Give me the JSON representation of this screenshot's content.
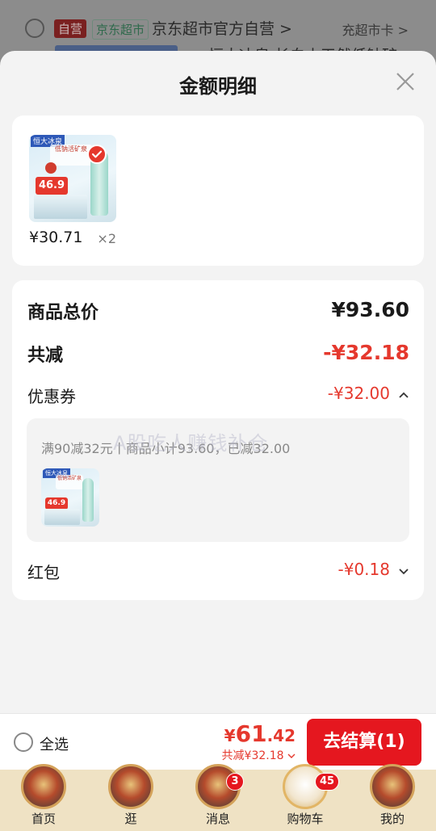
{
  "background": {
    "store_tag_self": "自营",
    "store_tag_jd": "京东超市",
    "store_name": "京东超市官方自营 >",
    "card_link": "充超市卡 >",
    "peek_text": "恒大冰泉 长白山天然低钠矿"
  },
  "sheet": {
    "title": "金额明细",
    "close_icon": "close-icon",
    "product": {
      "brand": "恒大冰泉",
      "banner": "低钠活矿泉",
      "promo_price": "46.9",
      "price": "¥30.71",
      "qty": "×2"
    },
    "summary": {
      "total_label": "商品总价",
      "total_value": "¥93.60",
      "discount_label": "共减",
      "discount_value": "-¥32.18",
      "coupon_label": "优惠券",
      "coupon_value": "-¥32.00",
      "coupon_desc": "满90减32元丨商品小计93.60，已减32.00",
      "redpacket_label": "红包",
      "redpacket_value": "-¥0.18"
    },
    "watermark": "A股吃人赚钱补仓"
  },
  "checkout": {
    "select_all": "全选",
    "currency": "¥",
    "amount_int": "61",
    "amount_dec": ".42",
    "saved": "共减¥32.18",
    "button": "去结算(1)"
  },
  "tabbar": {
    "items": [
      {
        "label": "首页",
        "badge": ""
      },
      {
        "label": "逛",
        "badge": ""
      },
      {
        "label": "消息",
        "badge": "3"
      },
      {
        "label": "购物车",
        "badge": "45"
      },
      {
        "label": "我的",
        "badge": ""
      }
    ]
  },
  "colors": {
    "accent_red": "#e5382d",
    "checkout_red": "#e5171f",
    "tabbar_bg": "#efe2c4"
  }
}
